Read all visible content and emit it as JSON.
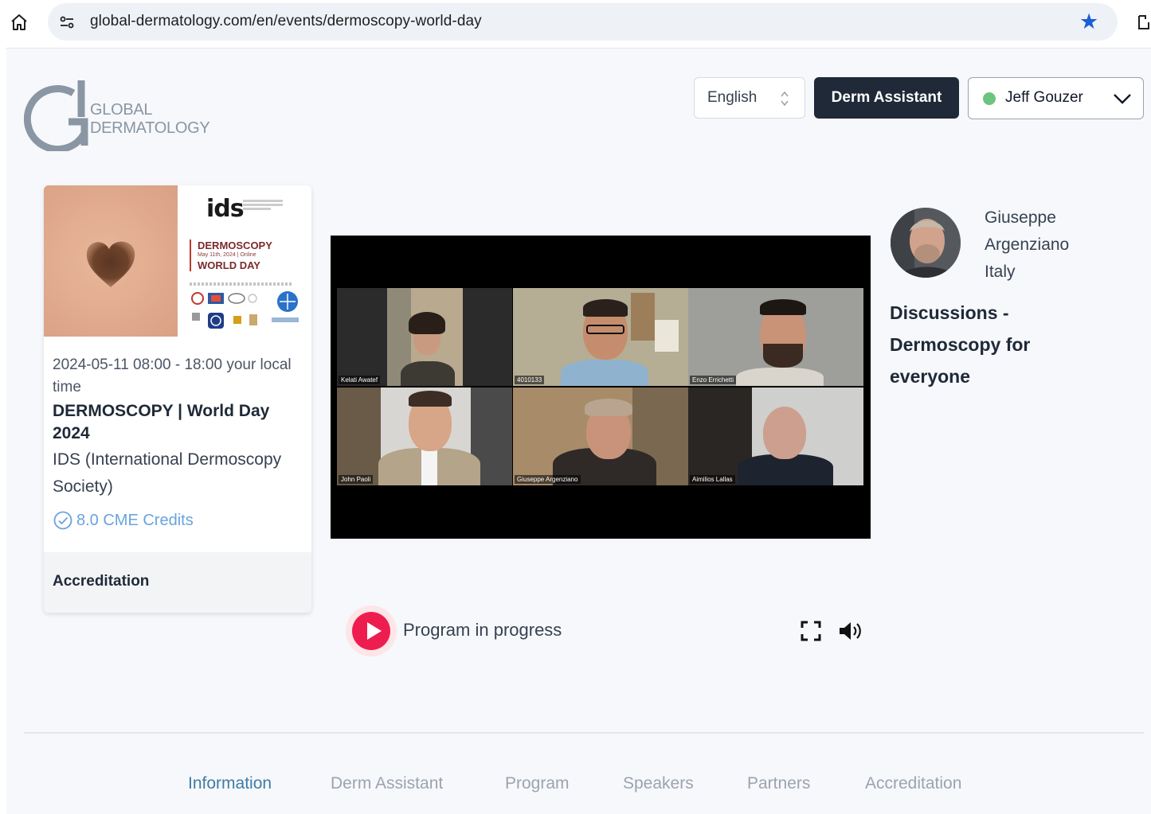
{
  "browser": {
    "url": "global-dermatology.com/en/events/dermoscopy-world-day"
  },
  "header": {
    "logo_line1": "GLOBAL",
    "logo_line2": "DERMATOLOGY",
    "language": "English",
    "derm_assistant_label": "Derm Assistant",
    "user_name": "Jeff Gouzer",
    "user_status_color": "#6cc47f"
  },
  "event_card": {
    "poster": {
      "brand": "ids",
      "title_line1": "DERMOSCOPY",
      "subtitle": "May 11th, 2024 | Online",
      "title_line2": "WORLD DAY"
    },
    "date_time": "2024-05-11   08:00 - 18:00 your local time",
    "title": "DERMOSCOPY | World Day 2024",
    "organizer": "IDS (International Dermoscopy Society)",
    "cme_credits": "8.0 CME Credits",
    "footer_label": "Accreditation"
  },
  "video": {
    "participants": [
      "Kelati Awatef",
      "4010133",
      "Enzo Errichetti",
      "John Paoli",
      "Giuseppe Argenziano",
      "Aimilios Lallas"
    ]
  },
  "speaker": {
    "name_line1": "Giuseppe",
    "name_line2": "Argenziano",
    "country": "Italy",
    "session_title": "Discussions - Dermoscopy for everyone"
  },
  "player": {
    "status": "Program in progress"
  },
  "tabs": [
    {
      "label": "Information",
      "active": true
    },
    {
      "label": "Derm Assistant",
      "active": false
    },
    {
      "label": "Program",
      "active": false
    },
    {
      "label": "Speakers",
      "active": false
    },
    {
      "label": "Partners",
      "active": false
    },
    {
      "label": "Accreditation",
      "active": false
    }
  ],
  "colors": {
    "accent_blue": "#3f7ca5",
    "play_red": "#ee1d4f",
    "cme_blue": "#6aa3dd",
    "dark_button": "#1f2937"
  }
}
